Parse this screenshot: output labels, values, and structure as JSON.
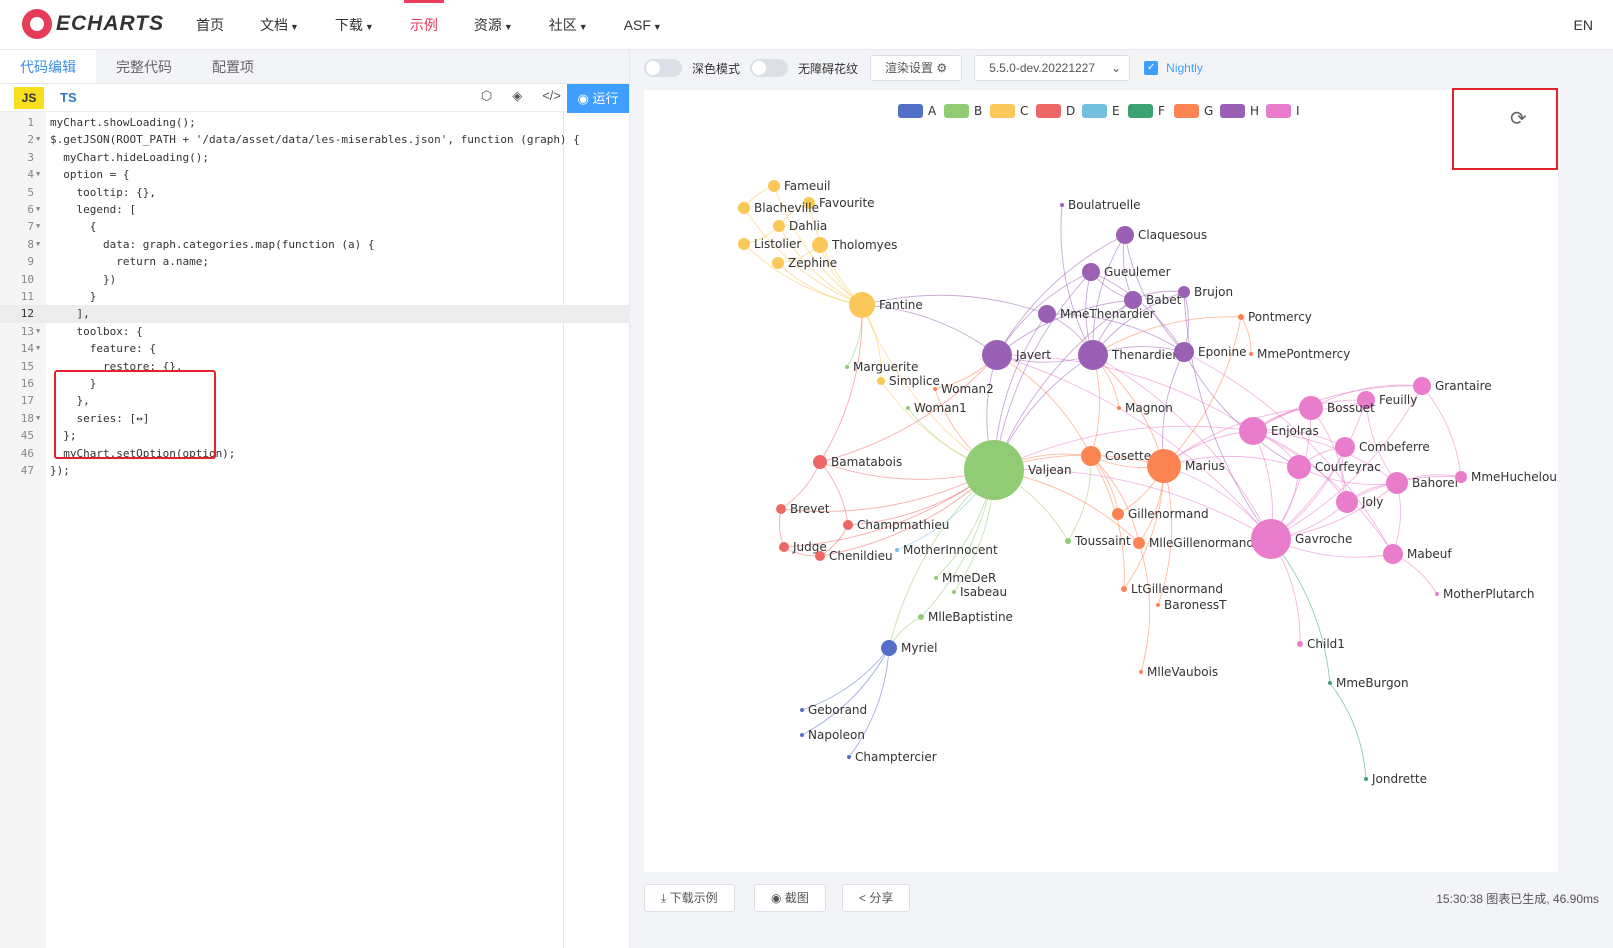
{
  "nav": {
    "brand": "ECHARTS",
    "items": [
      {
        "label": "首页",
        "caret": false,
        "active": false
      },
      {
        "label": "文档",
        "caret": true,
        "active": false
      },
      {
        "label": "下载",
        "caret": true,
        "active": false
      },
      {
        "label": "示例",
        "caret": false,
        "active": true
      },
      {
        "label": "资源",
        "caret": true,
        "active": false
      },
      {
        "label": "社区",
        "caret": true,
        "active": false
      },
      {
        "label": "ASF",
        "caret": true,
        "active": false
      }
    ],
    "lang": "EN"
  },
  "editor": {
    "tabs": [
      "代码编辑",
      "完整代码",
      "配置项"
    ],
    "js_label": "JS",
    "ts_label": "TS",
    "run_label": "运行",
    "lines": [
      {
        "n": "1",
        "fold": false,
        "text": "myChart.showLoading();"
      },
      {
        "n": "2",
        "fold": true,
        "text": "$.getJSON(ROOT_PATH + '/data/asset/data/les-miserables.json', function (graph) {"
      },
      {
        "n": "3",
        "fold": false,
        "text": "  myChart.hideLoading();"
      },
      {
        "n": "4",
        "fold": true,
        "text": "  option = {"
      },
      {
        "n": "5",
        "fold": false,
        "text": "    tooltip: {},"
      },
      {
        "n": "6",
        "fold": true,
        "text": "    legend: ["
      },
      {
        "n": "7",
        "fold": true,
        "text": "      {"
      },
      {
        "n": "8",
        "fold": true,
        "text": "        data: graph.categories.map(function (a) {"
      },
      {
        "n": "9",
        "fold": false,
        "text": "          return a.name;"
      },
      {
        "n": "10",
        "fold": false,
        "text": "        })"
      },
      {
        "n": "11",
        "fold": false,
        "text": "      }"
      },
      {
        "n": "12",
        "fold": false,
        "text": "    ],"
      },
      {
        "n": "13",
        "fold": true,
        "text": "    toolbox: {"
      },
      {
        "n": "14",
        "fold": true,
        "text": "      feature: {"
      },
      {
        "n": "15",
        "fold": false,
        "text": "        restore: {},"
      },
      {
        "n": "16",
        "fold": false,
        "text": "      }"
      },
      {
        "n": "17",
        "fold": false,
        "text": "    },"
      },
      {
        "n": "18",
        "fold": true,
        "text": "    series: [↔]"
      },
      {
        "n": "45",
        "fold": false,
        "text": "  };"
      },
      {
        "n": "46",
        "fold": false,
        "text": "  myChart.setOption(option);"
      },
      {
        "n": "47",
        "fold": false,
        "text": "});"
      }
    ]
  },
  "preview": {
    "dark_mode_label": "深色模式",
    "decal_label": "无障碍花纹",
    "render_settings_label": "渲染设置",
    "version": "5.5.0-dev.20221227",
    "nightly_label": "Nightly",
    "download_label": "下载示例",
    "screenshot_label": "截图",
    "share_label": "分享",
    "status": "15:30:38  图表已生成, 46.90ms"
  },
  "chart_data": {
    "type": "graph",
    "legend": [
      {
        "name": "A",
        "color": "#5470c6"
      },
      {
        "name": "B",
        "color": "#91cc75"
      },
      {
        "name": "C",
        "color": "#fac858"
      },
      {
        "name": "D",
        "color": "#ee6666"
      },
      {
        "name": "E",
        "color": "#73c0de"
      },
      {
        "name": "F",
        "color": "#3ba272"
      },
      {
        "name": "G",
        "color": "#fc8452"
      },
      {
        "name": "H",
        "color": "#9a60b4"
      },
      {
        "name": "I",
        "color": "#ea7ccc"
      }
    ],
    "nodes": [
      {
        "name": "Myriel",
        "cat": 0,
        "size": 8
      },
      {
        "name": "Napoleon",
        "cat": 0,
        "size": 1
      },
      {
        "name": "Geborand",
        "cat": 0,
        "size": 1
      },
      {
        "name": "Champtercier",
        "cat": 0,
        "size": 1
      },
      {
        "name": "Valjean",
        "cat": 1,
        "size": 30
      },
      {
        "name": "MlleBaptistine",
        "cat": 1,
        "size": 3
      },
      {
        "name": "MmeDeR",
        "cat": 1,
        "size": 1
      },
      {
        "name": "Isabeau",
        "cat": 1,
        "size": 1
      },
      {
        "name": "Woman1",
        "cat": 1,
        "size": 2
      },
      {
        "name": "Marguerite",
        "cat": 1,
        "size": 2
      },
      {
        "name": "Toussaint",
        "cat": 1,
        "size": 3
      },
      {
        "name": "Fantine",
        "cat": 2,
        "size": 13
      },
      {
        "name": "Fameuil",
        "cat": 2,
        "size": 6
      },
      {
        "name": "Favourite",
        "cat": 2,
        "size": 6
      },
      {
        "name": "Blacheville",
        "cat": 2,
        "size": 6
      },
      {
        "name": "Dahlia",
        "cat": 2,
        "size": 6
      },
      {
        "name": "Listolier",
        "cat": 2,
        "size": 6
      },
      {
        "name": "Tholomyes",
        "cat": 2,
        "size": 8
      },
      {
        "name": "Zephine",
        "cat": 2,
        "size": 6
      },
      {
        "name": "Simplice",
        "cat": 2,
        "size": 4
      },
      {
        "name": "Bamatabois",
        "cat": 3,
        "size": 7
      },
      {
        "name": "Brevet",
        "cat": 3,
        "size": 5
      },
      {
        "name": "Judge",
        "cat": 3,
        "size": 5
      },
      {
        "name": "Champmathieu",
        "cat": 3,
        "size": 5
      },
      {
        "name": "Chenildieu",
        "cat": 3,
        "size": 5
      },
      {
        "name": "MotherInnocent",
        "cat": 4,
        "size": 2
      },
      {
        "name": "Boulatruelle",
        "cat": 7,
        "size": 1
      },
      {
        "name": "Claquesous",
        "cat": 7,
        "size": 9
      },
      {
        "name": "Gueulemer",
        "cat": 7,
        "size": 9
      },
      {
        "name": "Babet",
        "cat": 7,
        "size": 9
      },
      {
        "name": "Brujon",
        "cat": 7,
        "size": 6
      },
      {
        "name": "MmeThenardier",
        "cat": 7,
        "size": 9
      },
      {
        "name": "Javert",
        "cat": 7,
        "size": 15
      },
      {
        "name": "Thenardier",
        "cat": 7,
        "size": 15
      },
      {
        "name": "Eponine",
        "cat": 7,
        "size": 10
      },
      {
        "name": "Pontmercy",
        "cat": 6,
        "size": 3
      },
      {
        "name": "MmePontmercy",
        "cat": 6,
        "size": 2
      },
      {
        "name": "Woman2",
        "cat": 6,
        "size": 2
      },
      {
        "name": "Magnon",
        "cat": 6,
        "size": 2
      },
      {
        "name": "Cosette",
        "cat": 6,
        "size": 10
      },
      {
        "name": "Marius",
        "cat": 6,
        "size": 17
      },
      {
        "name": "Gillenormand",
        "cat": 6,
        "size": 6
      },
      {
        "name": "MlleGillenormand",
        "cat": 6,
        "size": 6
      },
      {
        "name": "LtGillenormand",
        "cat": 6,
        "size": 3
      },
      {
        "name": "BaronessT",
        "cat": 6,
        "size": 2
      },
      {
        "name": "MlleVaubois",
        "cat": 6,
        "size": 1
      },
      {
        "name": "Grantaire",
        "cat": 8,
        "size": 9
      },
      {
        "name": "Feuilly",
        "cat": 8,
        "size": 9
      },
      {
        "name": "Bossuet",
        "cat": 8,
        "size": 12
      },
      {
        "name": "Enjolras",
        "cat": 8,
        "size": 14
      },
      {
        "name": "Combeferre",
        "cat": 8,
        "size": 10
      },
      {
        "name": "Courfeyrac",
        "cat": 8,
        "size": 12
      },
      {
        "name": "Bahorel",
        "cat": 8,
        "size": 11
      },
      {
        "name": "MmeHucheloup",
        "cat": 8,
        "size": 6
      },
      {
        "name": "Joly",
        "cat": 8,
        "size": 11
      },
      {
        "name": "Gavroche",
        "cat": 8,
        "size": 20
      },
      {
        "name": "Mabeuf",
        "cat": 8,
        "size": 10
      },
      {
        "name": "MotherPlutarch",
        "cat": 8,
        "size": 2
      },
      {
        "name": "Child1",
        "cat": 8,
        "size": 3
      },
      {
        "name": "MmeBurgon",
        "cat": 5,
        "size": 2
      },
      {
        "name": "Jondrette",
        "cat": 5,
        "size": 1
      }
    ]
  }
}
